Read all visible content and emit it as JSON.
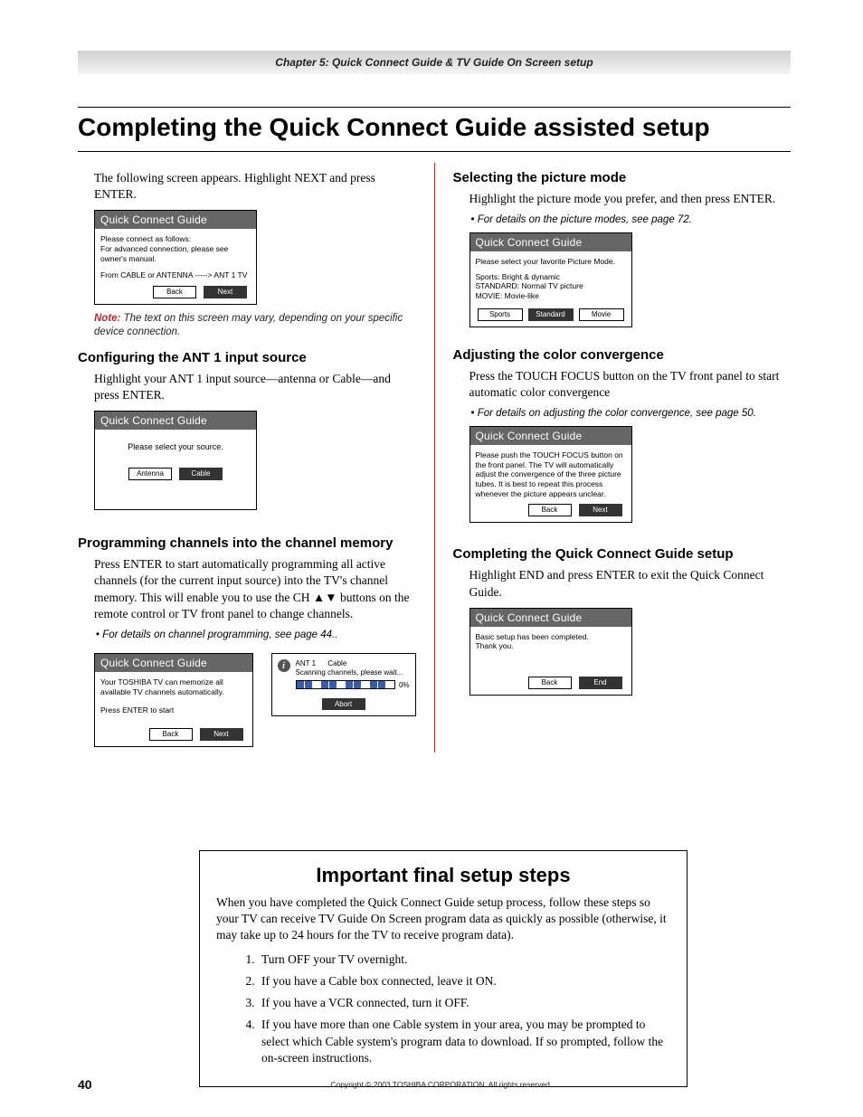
{
  "header": {
    "chapter_line": "Chapter 5: Quick Connect Guide & TV Guide On Screen setup"
  },
  "title": "Completing the Quick Connect Guide assisted setup",
  "left": {
    "intro": "The following screen appears. Highlight NEXT and press ENTER.",
    "osd1": {
      "title": "Quick Connect Guide",
      "line1": "Please connect as follows:",
      "line2": "For advanced connection, please see owner's manual.",
      "line3": "From CABLE or ANTENNA -----> ANT 1 TV",
      "back": "Back",
      "next": "Next"
    },
    "note_label": "Note:",
    "note_text": " The text on this screen may vary, depending on your specific device connection.",
    "h_ant": "Configuring the ANT 1 input source",
    "ant_text": "Highlight your ANT 1 input source—antenna or Cable—and press ENTER.",
    "osd2": {
      "title": "Quick Connect Guide",
      "prompt": "Please select your source.",
      "antenna": "Antenna",
      "cable": "Cable"
    },
    "h_prog": "Programming channels into the channel memory",
    "prog_text1": "Press ENTER to start automatically programming all active channels (for the current input source) into the TV's channel memory. This will enable you to use the CH ",
    "prog_arrows": "▲▼",
    "prog_text2": " buttons on the remote control or TV front panel to change channels.",
    "prog_bullet": "For details on channel programming, see page 44..",
    "osd3": {
      "title": "Quick Connect Guide",
      "line1": "Your TOSHIBA TV can memorize all available TV channels automatically.",
      "line2": "Press ENTER to start",
      "back": "Back",
      "next": "Next"
    },
    "scan": {
      "head1": "ANT 1      Cable",
      "head2": "Scanning channels, please wait...",
      "pct": "0%",
      "abort": "Abort"
    }
  },
  "right": {
    "h_pic": "Selecting the picture mode",
    "pic_text": "Highlight the picture mode you prefer, and then press ENTER.",
    "pic_bullet": "For details on the picture modes, see page 72.",
    "osd_pic": {
      "title": "Quick Connect Guide",
      "line1": "Please select your favorite Picture Mode.",
      "line2": "Sports: Bright & dynamic",
      "line3": "STANDARD: Normal TV picture",
      "line4": "MOVIE: Movie-like",
      "sports": "Sports",
      "standard": "Standard",
      "movie": "Movie"
    },
    "h_color": "Adjusting the color convergence",
    "color_text": "Press the TOUCH FOCUS button on the TV front panel to start automatic color convergence",
    "color_bullet": "For details on adjusting the color convergence, see page 50.",
    "osd_color": {
      "title": "Quick Connect Guide",
      "body": "Please push the TOUCH FOCUS button on the front panel. The TV will automatically adjust the convergence of the three picture tubes. It is best to repeat this process whenever the picture appears unclear.",
      "back": "Back",
      "next": "Next"
    },
    "h_complete": "Completing the Quick Connect Guide setup",
    "complete_text": "Highlight END and press ENTER to exit the Quick Connect Guide.",
    "osd_complete": {
      "title": "Quick Connect Guide",
      "line1": "Basic setup has been completed.",
      "line2": "Thank you.",
      "back": "Back",
      "end": "End"
    }
  },
  "important": {
    "title": "Important final setup steps",
    "intro": "When you have completed the Quick Connect Guide setup process, follow these steps so your TV can receive TV Guide On Screen program data as quickly as possible (otherwise, it may take up to 24 hours for the TV to receive program data).",
    "items": [
      "Turn OFF your TV overnight.",
      "If you have a Cable box connected, leave it ON.",
      "If you have a VCR connected, turn it OFF.",
      "If you have more than one Cable system in your area, you may be prompted to select which Cable system's program data to download. If so prompted, follow the on-screen instructions."
    ]
  },
  "footer": {
    "page": "40",
    "copyright": "Copyright © 2003 TOSHIBA CORPORATION. All rights reserved."
  }
}
